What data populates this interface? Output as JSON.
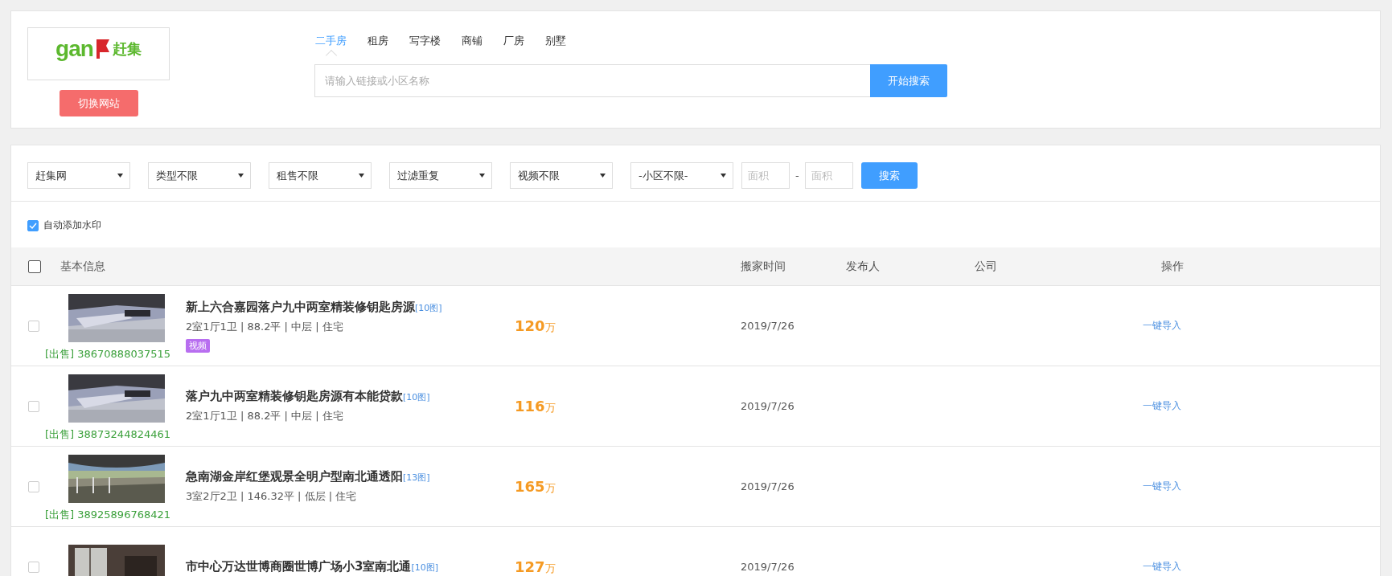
{
  "logo": {
    "latin": "gan",
    "chinese": "赶集"
  },
  "switch_button": "切换网站",
  "tabs": [
    {
      "label": "二手房",
      "selected": true
    },
    {
      "label": "租房",
      "selected": false
    },
    {
      "label": "写字楼",
      "selected": false
    },
    {
      "label": "商铺",
      "selected": false
    },
    {
      "label": "厂房",
      "selected": false
    },
    {
      "label": "别墅",
      "selected": false
    }
  ],
  "search": {
    "placeholder": "请输入链接或小区名称",
    "button": "开始搜索"
  },
  "filters": [
    {
      "value": "赶集网"
    },
    {
      "value": "类型不限"
    },
    {
      "value": "租售不限"
    },
    {
      "value": "过滤重复"
    },
    {
      "value": "视频不限"
    },
    {
      "value": "-小区不限-"
    }
  ],
  "area": {
    "min_placeholder": "面积",
    "separator": "-",
    "max_placeholder": "面积"
  },
  "filter_button": "搜索",
  "watermark_option": {
    "label": "自动添加水印",
    "checked": true
  },
  "table": {
    "select_all_checked": false,
    "columns": [
      "基本信息",
      "搬家时间",
      "发布人",
      "公司",
      "操作"
    ],
    "rows": [
      {
        "checked": false,
        "photo": {
          "kind": "picture"
        },
        "listing_id": "[出售] 38670888037515",
        "title": "新上六合嘉园落户九中两室精装修钥匙房源",
        "photo_count": "[10图]",
        "specs": "2室1厅1卫 | 88.2平 | 中层 | 住宅",
        "tags": [
          "视频"
        ],
        "price": "120",
        "price_unit": "万",
        "date": "2019/7/26",
        "action": "一键导入"
      },
      {
        "checked": false,
        "photo": {
          "kind": "picture"
        },
        "listing_id": "[出售] 38873244824461",
        "title": "落户九中两室精装修钥匙房源有本能贷款",
        "photo_count": "[10图]",
        "specs": "2室1厅1卫 | 88.2平 | 中层 | 住宅",
        "tags": [],
        "price": "116",
        "price_unit": "万",
        "date": "2019/7/26",
        "action": "一键导入"
      },
      {
        "checked": false,
        "photo": {
          "kind": "picture"
        },
        "listing_id": "[出售] 38925896768421",
        "title": "急南湖金岸红堡观景全明户型南北通透阳",
        "photo_count": "[13图]",
        "specs": "3室2厅2卫 | 146.32平 | 低层 | 住宅",
        "tags": [],
        "price": "165",
        "price_unit": "万",
        "date": "2019/7/26",
        "action": "一键导入"
      },
      {
        "checked": false,
        "photo": {
          "kind": "picture"
        },
        "title": "市中心万达世博商圈世博广场小3室南北通",
        "photo_count": "[10图]",
        "price": "127",
        "price_unit": "万",
        "date": "2019/7/26",
        "action": "一键导入"
      }
    ]
  }
}
